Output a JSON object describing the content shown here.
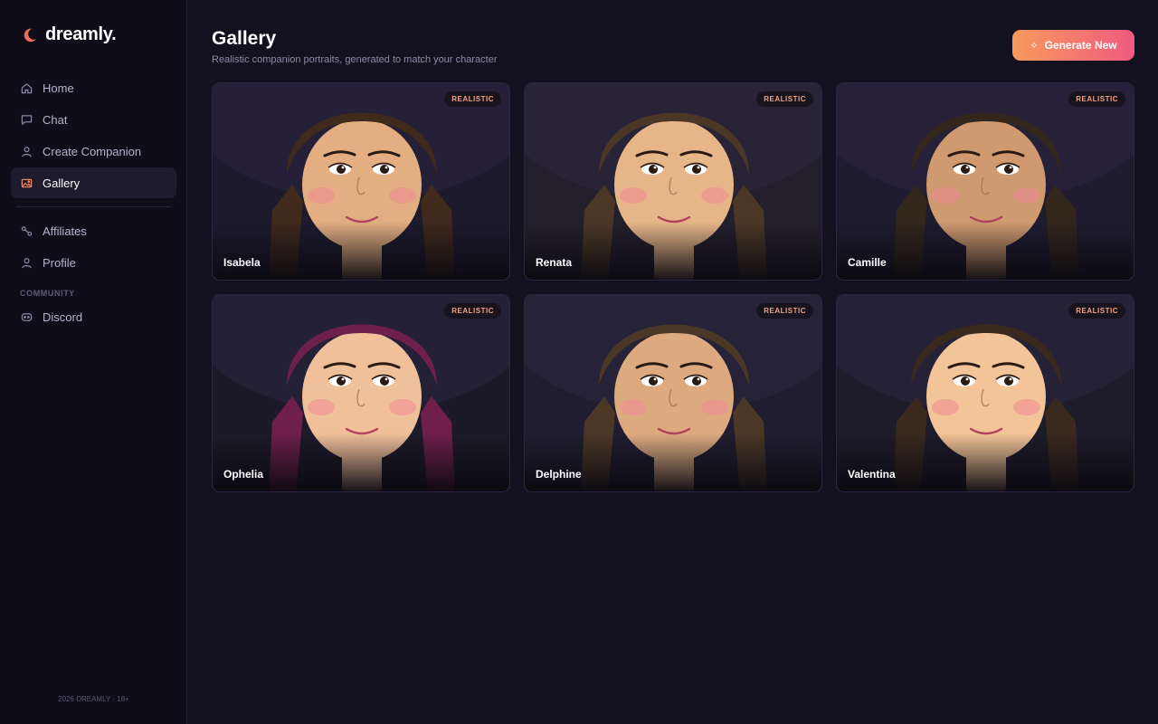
{
  "brand": {
    "name": "dreamly.",
    "logo_icon": "moon-icon",
    "accent": "#f26b5b"
  },
  "nav": {
    "items": [
      {
        "label": "Home",
        "icon": "home-icon",
        "active": false
      },
      {
        "label": "Chat",
        "icon": "chat-icon",
        "active": false
      },
      {
        "label": "Create Companion",
        "icon": "user-icon",
        "active": false
      },
      {
        "label": "Gallery",
        "icon": "image-icon",
        "active": true
      }
    ],
    "items2": [
      {
        "label": "Affiliates",
        "icon": "link-icon"
      },
      {
        "label": "Profile",
        "icon": "user-icon"
      }
    ],
    "community_label": "COMMUNITY",
    "community_items": [
      {
        "label": "Discord",
        "icon": "discord-icon"
      }
    ],
    "footer": "2026 DREAMLY · 18+"
  },
  "page": {
    "title": "Gallery",
    "subtitle": "Realistic companion portraits, generated to match your character",
    "generate_label": "Generate New",
    "generate_icon": "sparkle-icon",
    "button_gradient": [
      "#f79a5c",
      "#f05a80"
    ]
  },
  "gallery": {
    "cards": [
      {
        "name": "Isabela",
        "badge": "REALISTIC",
        "hair": "#3f2a1c",
        "skin": "#e3ae82",
        "bg": "#1d1a2e"
      },
      {
        "name": "Renata",
        "badge": "REALISTIC",
        "hair": "#4a3726",
        "skin": "#e6b688",
        "bg": "#241f2c"
      },
      {
        "name": "Camille",
        "badge": "REALISTIC",
        "hair": "#33261b",
        "skin": "#cf9a70",
        "bg": "#1f1c30"
      },
      {
        "name": "Ophelia",
        "badge": "REALISTIC",
        "hair": "#6e1f4c",
        "skin": "#f0c09a",
        "bg": "#1c1a28"
      },
      {
        "name": "Delphine",
        "badge": "REALISTIC",
        "hair": "#4a3726",
        "skin": "#ddaa80",
        "bg": "#201d30"
      },
      {
        "name": "Valentina",
        "badge": "REALISTIC",
        "hair": "#3a2a1e",
        "skin": "#f2c497",
        "bg": "#1e1b2a"
      }
    ]
  }
}
